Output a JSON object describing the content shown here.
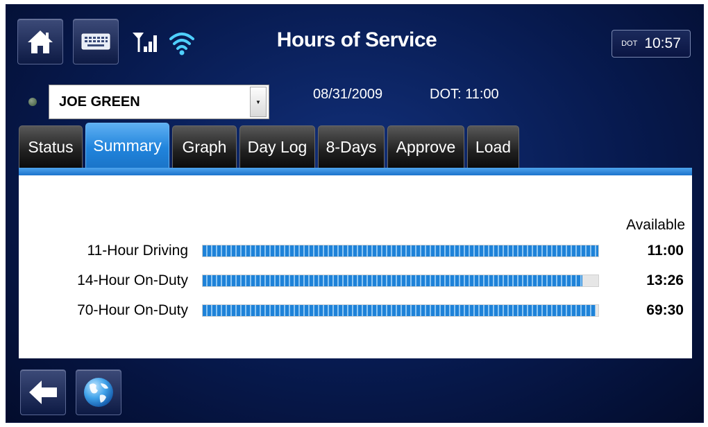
{
  "header": {
    "title": "Hours of Service",
    "clock_dot_label": "DOT",
    "clock_time": "10:57",
    "icons": [
      "home-icon",
      "keyboard-icon",
      "cell-signal-icon",
      "wifi-icon"
    ]
  },
  "driver": {
    "name": "JOE GREEN",
    "status_color": "#4a6b48"
  },
  "info": {
    "date": "08/31/2009",
    "dot": "DOT: 11:00"
  },
  "tabs": [
    {
      "label": "Status",
      "active": false
    },
    {
      "label": "Summary",
      "active": true
    },
    {
      "label": "Graph",
      "active": false
    },
    {
      "label": "Day Log",
      "active": false
    },
    {
      "label": "8-Days",
      "active": false
    },
    {
      "label": "Approve",
      "active": false
    },
    {
      "label": "Load",
      "active": false
    }
  ],
  "summary": {
    "available_header": "Available",
    "rows": [
      {
        "label": "11-Hour Driving",
        "value": "11:00",
        "fraction": 1.0
      },
      {
        "label": "14-Hour On-Duty",
        "value": "13:26",
        "fraction": 0.96
      },
      {
        "label": "70-Hour On-Duty",
        "value": "69:30",
        "fraction": 0.993
      }
    ]
  },
  "footer": {
    "icons": [
      "back-arrow-icon",
      "globe-icon"
    ]
  },
  "colors": {
    "accent": "#2184dc",
    "bar": "#1e82d8",
    "background": "#071a4f"
  }
}
